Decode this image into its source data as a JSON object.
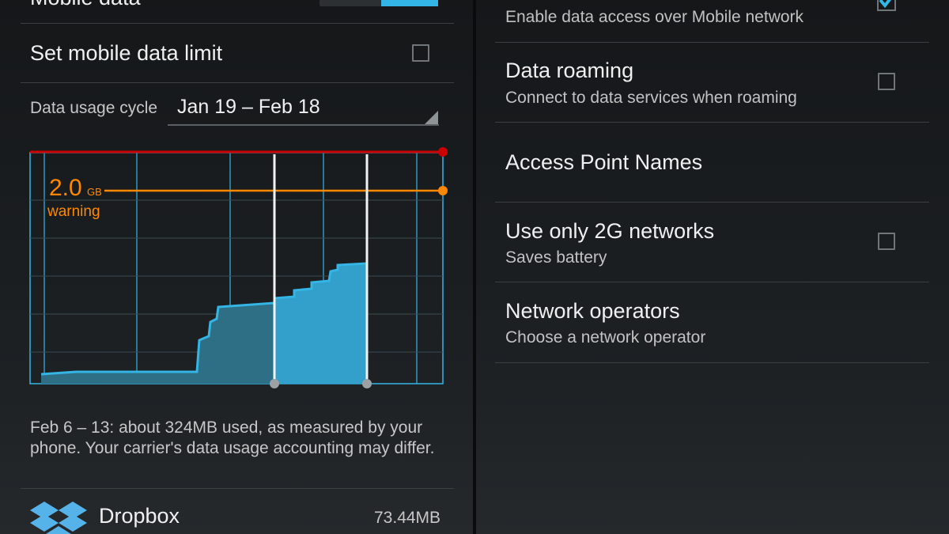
{
  "left": {
    "mobile_data_label": "Mobile data",
    "mobile_data_enabled": true,
    "set_limit_label": "Set mobile data limit",
    "set_limit_checked": false,
    "cycle_label": "Data usage cycle",
    "cycle_value": "Jan 19 – Feb 18",
    "warning_value": "2.0",
    "warning_unit": "GB",
    "warning_label": "warning",
    "summary": "Feb 6 – 13: about 324MB used, as measured by your phone. Your carrier's data usage accounting may differ.",
    "apps": [
      {
        "name": "Dropbox",
        "size": "73.44MB",
        "icon": "dropbox-icon"
      }
    ]
  },
  "right": {
    "mobile_data_subtitle": "Enable data access over Mobile network",
    "mobile_data_checked": true,
    "data_roaming_title": "Data roaming",
    "data_roaming_subtitle": "Connect to data services when roaming",
    "data_roaming_checked": false,
    "apn_title": "Access Point Names",
    "use_2g_title": "Use only 2G networks",
    "use_2g_subtitle": "Saves battery",
    "use_2g_checked": false,
    "network_operators_title": "Network operators",
    "network_operators_subtitle": "Choose a network operator"
  },
  "colors": {
    "accent": "#33b5e5",
    "limit_line": "#cc0000",
    "warning_line": "#ff8800"
  }
}
